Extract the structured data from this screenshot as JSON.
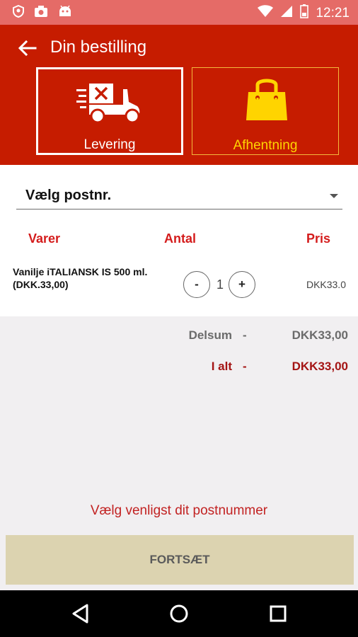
{
  "status_bar": {
    "time": "12:21",
    "left_icons": [
      "shield-icon",
      "camera-icon",
      "android-icon"
    ],
    "right_icons": [
      "wifi-icon",
      "signal-icon",
      "battery-icon"
    ]
  },
  "header": {
    "title": "Din bestilling",
    "back_icon": "arrow-left-icon",
    "background_color": "#c61c00"
  },
  "modes": [
    {
      "label": "Levering",
      "icon": "delivery-scooter-icon",
      "selected": true
    },
    {
      "label": "Afhentning",
      "icon": "shopping-bag-icon",
      "selected": false
    }
  ],
  "postal_select": {
    "value": "Vælg postnr."
  },
  "table": {
    "headers": {
      "items": "Varer",
      "quantity": "Antal",
      "price": "Pris"
    },
    "rows": [
      {
        "name": "Vanilje iTALIANSK IS 500 ml.",
        "unit_price": "(DKK.33,00)",
        "quantity": "1",
        "decrement_label": "-",
        "increment_label": "+",
        "price": "DKK33.0"
      }
    ]
  },
  "totals": {
    "subtotal_label": "Delsum",
    "subtotal_dash": "-",
    "subtotal_value": "DKK33,00",
    "total_label": "I alt",
    "total_dash": "-",
    "total_value": "DKK33,00"
  },
  "notice": "Vælg venligst dit postnummer",
  "continue_button": "FORTSÆT",
  "nav_bar": [
    "back-triangle-icon",
    "home-circle-icon",
    "recents-square-icon"
  ],
  "colors": {
    "status_bar": "#e56b67",
    "accent_red": "#c61c00",
    "pickup_yellow": "#ffd400",
    "button_beige": "#dcd3b0"
  }
}
